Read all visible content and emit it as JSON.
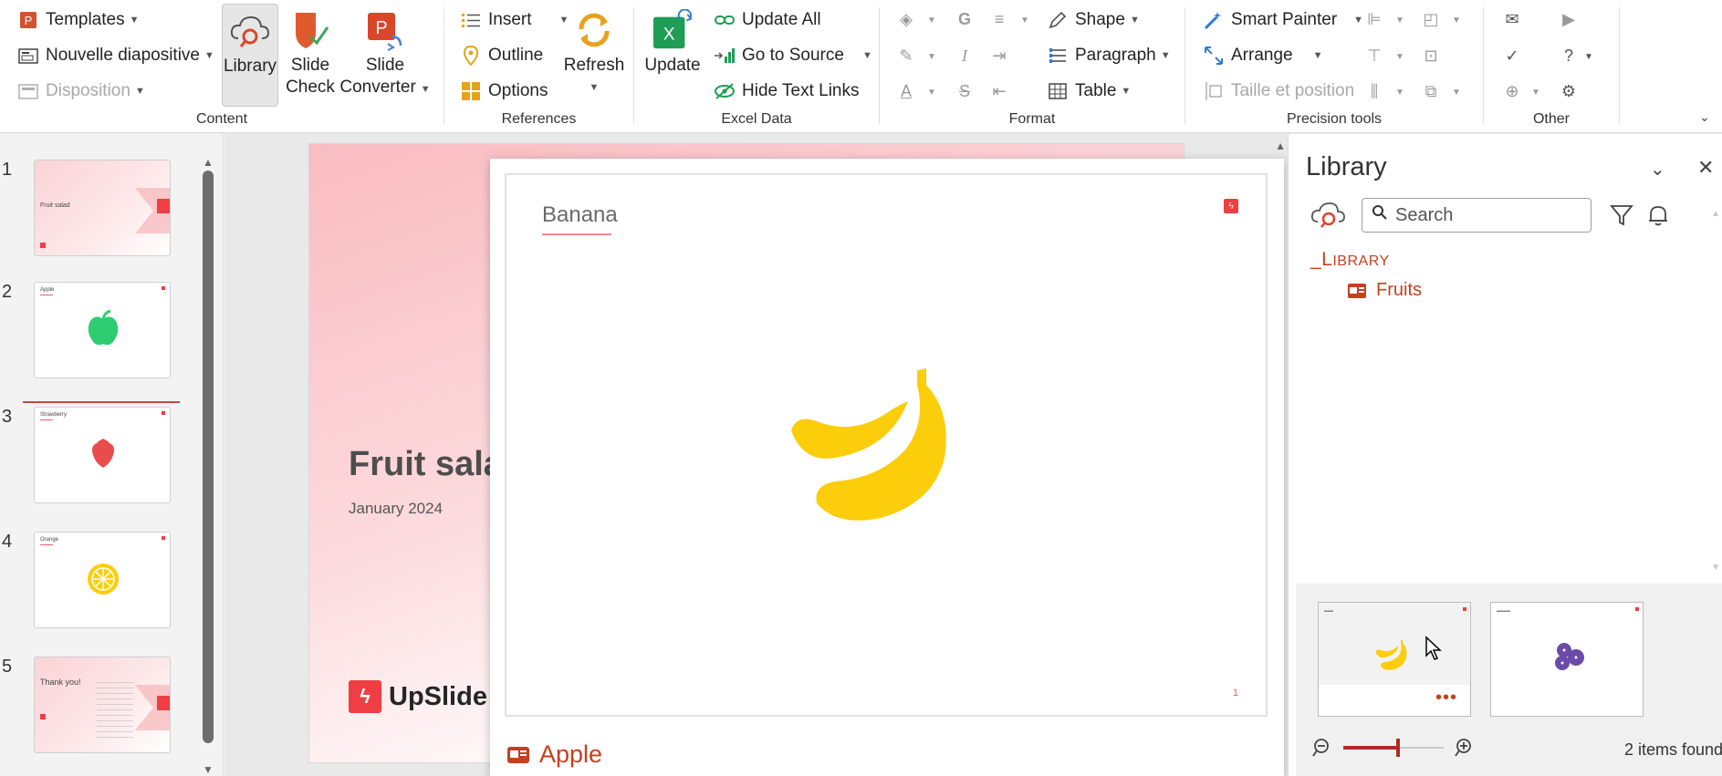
{
  "ribbon": {
    "content": {
      "label": "Content",
      "templates": "Templates",
      "new_slide": "Nouvelle diapositive",
      "layout": "Disposition",
      "library": "Library",
      "slide_check_1": "Slide",
      "slide_check_2": "Check",
      "slide_converter_1": "Slide",
      "slide_converter_2": "Converter"
    },
    "references": {
      "label": "References",
      "insert": "Insert",
      "outline": "Outline",
      "options": "Options",
      "refresh": "Refresh"
    },
    "excel": {
      "label": "Excel Data",
      "update": "Update",
      "update_all": "Update All",
      "go_to_source": "Go to Source",
      "hide_text_links": "Hide Text Links"
    },
    "format": {
      "label": "Format",
      "bold": "G",
      "italic": "I",
      "strike": "S",
      "font_color": "A",
      "shape": "Shape",
      "paragraph": "Paragraph",
      "table": "Table"
    },
    "precision": {
      "label": "Precision tools",
      "smart_painter": "Smart Painter",
      "arrange": "Arrange",
      "size_position": "Taille et position"
    },
    "other": {
      "label": "Other"
    }
  },
  "thumbnails": [
    {
      "num": "1",
      "title": "Fruit salad"
    },
    {
      "num": "2",
      "title": "Apple"
    },
    {
      "num": "3",
      "title": "Strawberry"
    },
    {
      "num": "4",
      "title": "Orange"
    },
    {
      "num": "5",
      "title": "Thank you!"
    }
  ],
  "slide": {
    "title": "Fruit sala",
    "subtitle": "January 2024",
    "logo": "UpSlide"
  },
  "preview": {
    "title": "Banana",
    "page": "1",
    "footer": "Apple"
  },
  "library": {
    "title": "Library",
    "search_placeholder": "Search",
    "root_first": "_L",
    "root_rest": "IBRARY",
    "folder": "Fruits",
    "count": "2 items found"
  },
  "colors": {
    "accent": "#c5401f",
    "brand_red": "#ef3e44",
    "banana": "#fccd0b"
  }
}
